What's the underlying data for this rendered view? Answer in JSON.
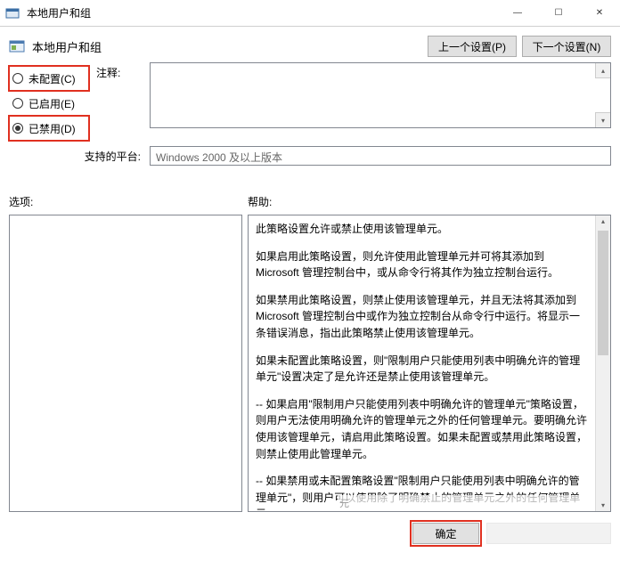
{
  "window": {
    "title": "本地用户和组",
    "min_icon": "—",
    "max_icon": "☐",
    "close_icon": "✕"
  },
  "header": {
    "title": "本地用户和组",
    "prev_label": "上一个设置(P)",
    "next_label": "下一个设置(N)"
  },
  "radios": {
    "notconfigured": "未配置(C)",
    "enabled": "已启用(E)",
    "disabled": "已禁用(D)"
  },
  "comment": {
    "label": "注释:"
  },
  "platform": {
    "label": "支持的平台:",
    "value": "Windows 2000 及以上版本"
  },
  "section": {
    "options": "选项:",
    "help": "帮助:"
  },
  "help": {
    "p1": "此策略设置允许或禁止使用该管理单元。",
    "p2": "如果启用此策略设置，则允许使用此管理单元并可将其添加到 Microsoft 管理控制台中，或从命令行将其作为独立控制台运行。",
    "p3": "如果禁用此策略设置，则禁止使用该管理单元，并且无法将其添加到 Microsoft 管理控制台中或作为独立控制台从命令行中运行。将显示一条错误消息，指出此策略禁止使用该管理单元。",
    "p4": "如果未配置此策略设置，则\"限制用户只能使用列表中明确允许的管理单元\"设置决定了是允许还是禁止使用该管理单元。",
    "p5": "--  如果启用\"限制用户只能使用列表中明确允许的管理单元\"策略设置，则用户无法使用明确允许的管理单元之外的任何管理单元。要明确允许使用该管理单元，请启用此策略设置。如果未配置或禁用此策略设置，则禁止使用此管理单元。",
    "p6": "--  如果禁用或未配置策略设置\"限制用户只能使用列表中明确允许的管理单元\"，则用户可以使用除了明确禁止的管理单元之外的任何管理单元"
  },
  "overlay": "元",
  "footer": {
    "ok": "确定"
  }
}
